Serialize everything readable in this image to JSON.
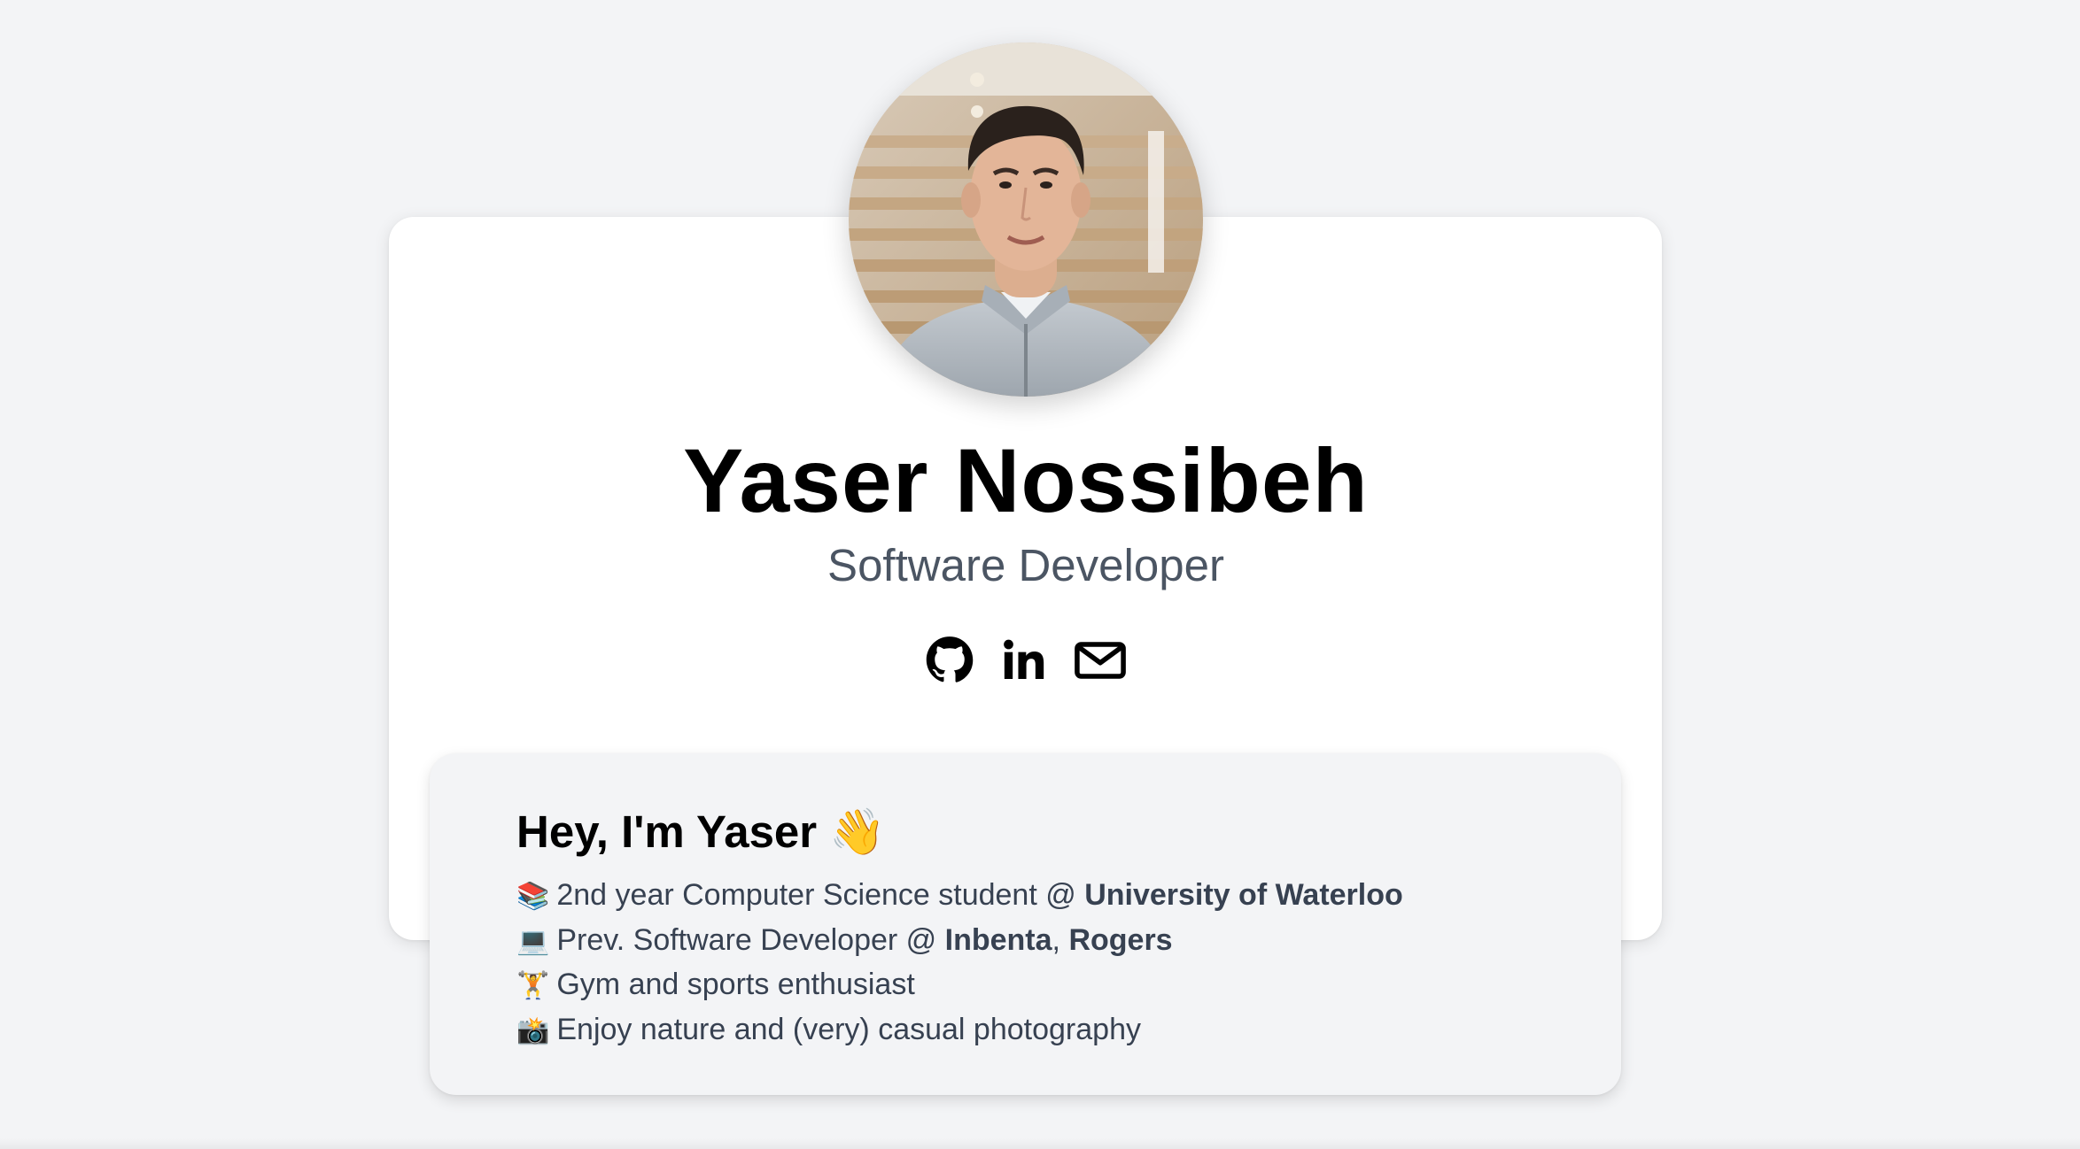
{
  "profile": {
    "name": "Yaser Nossibeh",
    "title": "Software Developer"
  },
  "social": {
    "github_icon": "github-icon",
    "linkedin_icon": "linkedin-icon",
    "email_icon": "mail-icon"
  },
  "about": {
    "heading": "Hey, I'm Yaser",
    "heading_emoji": "👋",
    "items": [
      {
        "emoji": "📚",
        "text": "2nd year Computer Science student @ ",
        "bold": "University of Waterloo"
      },
      {
        "emoji": "💻",
        "text": "Prev. Software Developer @ ",
        "bold_1": "Inbenta",
        "separator": ", ",
        "bold_2": "Rogers"
      },
      {
        "emoji": "🏋️",
        "text": "Gym and sports enthusiast"
      },
      {
        "emoji": "📸",
        "text": "Enjoy nature and (very) casual photography"
      }
    ]
  },
  "colors": {
    "page_background": "#f3f4f6",
    "card_background": "#ffffff",
    "subtitle": "#4b5563",
    "body_text": "#374151"
  }
}
